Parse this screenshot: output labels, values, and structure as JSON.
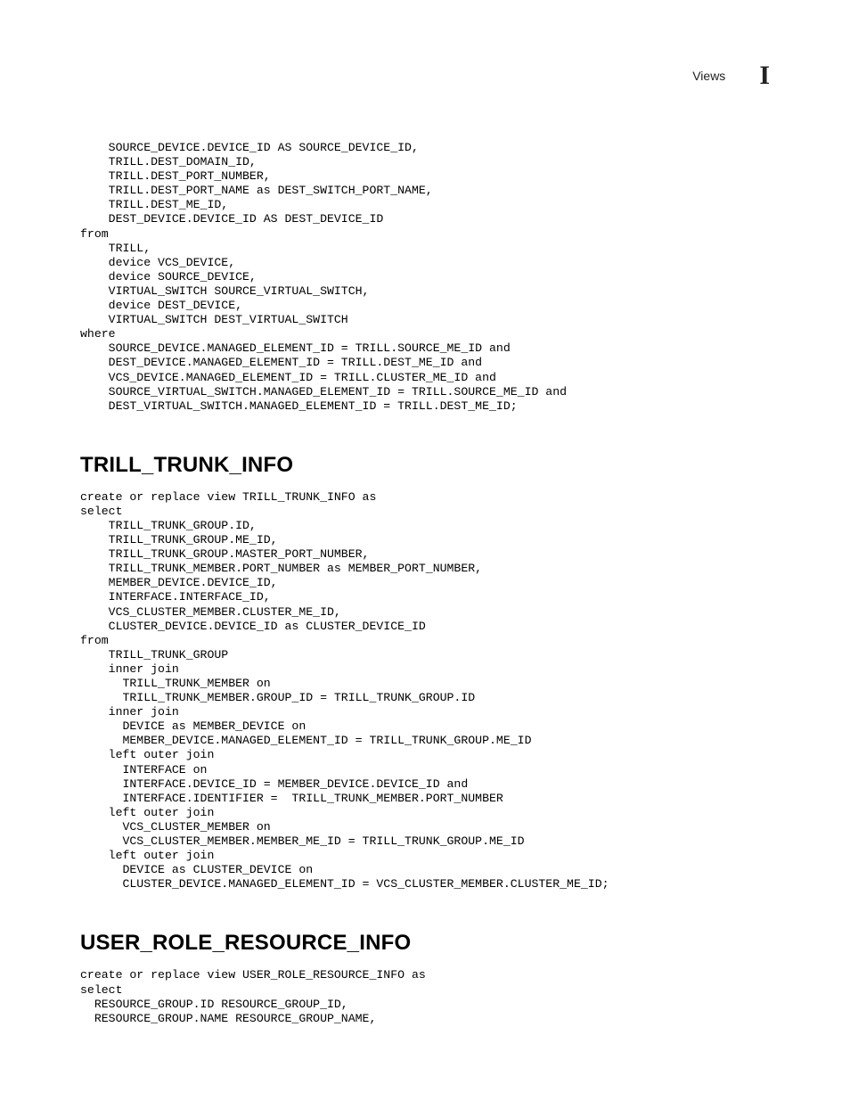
{
  "header": {
    "section_label": "Views",
    "appendix_letter": "I"
  },
  "code1": "    SOURCE_DEVICE.DEVICE_ID AS SOURCE_DEVICE_ID,\n    TRILL.DEST_DOMAIN_ID,\n    TRILL.DEST_PORT_NUMBER,\n    TRILL.DEST_PORT_NAME as DEST_SWITCH_PORT_NAME,\n    TRILL.DEST_ME_ID,\n    DEST_DEVICE.DEVICE_ID AS DEST_DEVICE_ID\nfrom\n    TRILL,\n    device VCS_DEVICE,\n    device SOURCE_DEVICE,\n    VIRTUAL_SWITCH SOURCE_VIRTUAL_SWITCH,\n    device DEST_DEVICE,\n    VIRTUAL_SWITCH DEST_VIRTUAL_SWITCH\nwhere\n    SOURCE_DEVICE.MANAGED_ELEMENT_ID = TRILL.SOURCE_ME_ID and\n    DEST_DEVICE.MANAGED_ELEMENT_ID = TRILL.DEST_ME_ID and\n    VCS_DEVICE.MANAGED_ELEMENT_ID = TRILL.CLUSTER_ME_ID and\n    SOURCE_VIRTUAL_SWITCH.MANAGED_ELEMENT_ID = TRILL.SOURCE_ME_ID and\n    DEST_VIRTUAL_SWITCH.MANAGED_ELEMENT_ID = TRILL.DEST_ME_ID;",
  "heading1": "TRILL_TRUNK_INFO",
  "code2": "create or replace view TRILL_TRUNK_INFO as\nselect\n    TRILL_TRUNK_GROUP.ID,\n    TRILL_TRUNK_GROUP.ME_ID,\n    TRILL_TRUNK_GROUP.MASTER_PORT_NUMBER,\n    TRILL_TRUNK_MEMBER.PORT_NUMBER as MEMBER_PORT_NUMBER,\n    MEMBER_DEVICE.DEVICE_ID,\n    INTERFACE.INTERFACE_ID,\n    VCS_CLUSTER_MEMBER.CLUSTER_ME_ID,\n    CLUSTER_DEVICE.DEVICE_ID as CLUSTER_DEVICE_ID\nfrom\n    TRILL_TRUNK_GROUP\n    inner join\n      TRILL_TRUNK_MEMBER on\n      TRILL_TRUNK_MEMBER.GROUP_ID = TRILL_TRUNK_GROUP.ID\n    inner join\n      DEVICE as MEMBER_DEVICE on\n      MEMBER_DEVICE.MANAGED_ELEMENT_ID = TRILL_TRUNK_GROUP.ME_ID\n    left outer join\n      INTERFACE on\n      INTERFACE.DEVICE_ID = MEMBER_DEVICE.DEVICE_ID and\n      INTERFACE.IDENTIFIER =  TRILL_TRUNK_MEMBER.PORT_NUMBER\n    left outer join\n      VCS_CLUSTER_MEMBER on\n      VCS_CLUSTER_MEMBER.MEMBER_ME_ID = TRILL_TRUNK_GROUP.ME_ID\n    left outer join\n      DEVICE as CLUSTER_DEVICE on\n      CLUSTER_DEVICE.MANAGED_ELEMENT_ID = VCS_CLUSTER_MEMBER.CLUSTER_ME_ID;",
  "heading2": "USER_ROLE_RESOURCE_INFO",
  "code3": "create or replace view USER_ROLE_RESOURCE_INFO as\nselect\n  RESOURCE_GROUP.ID RESOURCE_GROUP_ID,\n  RESOURCE_GROUP.NAME RESOURCE_GROUP_NAME,"
}
